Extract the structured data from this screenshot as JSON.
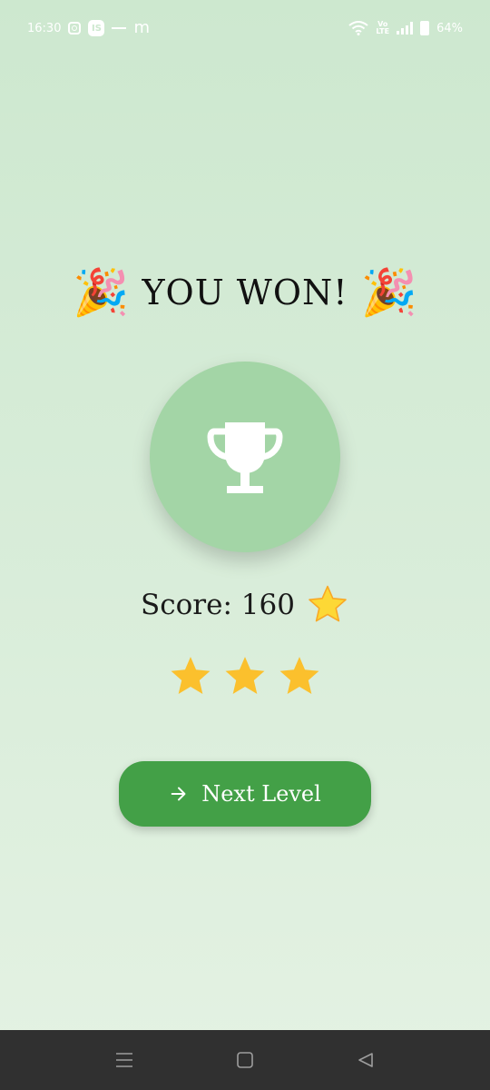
{
  "status_bar": {
    "time": "16:30",
    "notification_icons": [
      "instagram-icon",
      "is-app-icon",
      "dash-icon",
      "m-app-icon"
    ],
    "is_label": "IS",
    "m_label": "m",
    "volte_top": "Vo",
    "volte_bottom": "LTE",
    "battery": "64%"
  },
  "result": {
    "title": "YOU WON!",
    "left_icon": "🎉",
    "right_icon": "🎉",
    "trophy_icon": "trophy-icon"
  },
  "score": {
    "text": "Score: 160",
    "icon": "star-icon"
  },
  "rating": {
    "earned": 3,
    "total": 3
  },
  "next_button": {
    "label": "Next Level",
    "icon": "arrow-right-icon"
  },
  "nav_bar": {
    "items": [
      "menu-icon",
      "home-icon",
      "back-icon"
    ]
  },
  "colors": {
    "background_top": "#cde8cf",
    "background_bottom": "#e4f2e3",
    "trophy_circle": "#a3d5a6",
    "button": "#43a047",
    "star": "#fbc02d",
    "nav_bar": "#303030"
  }
}
